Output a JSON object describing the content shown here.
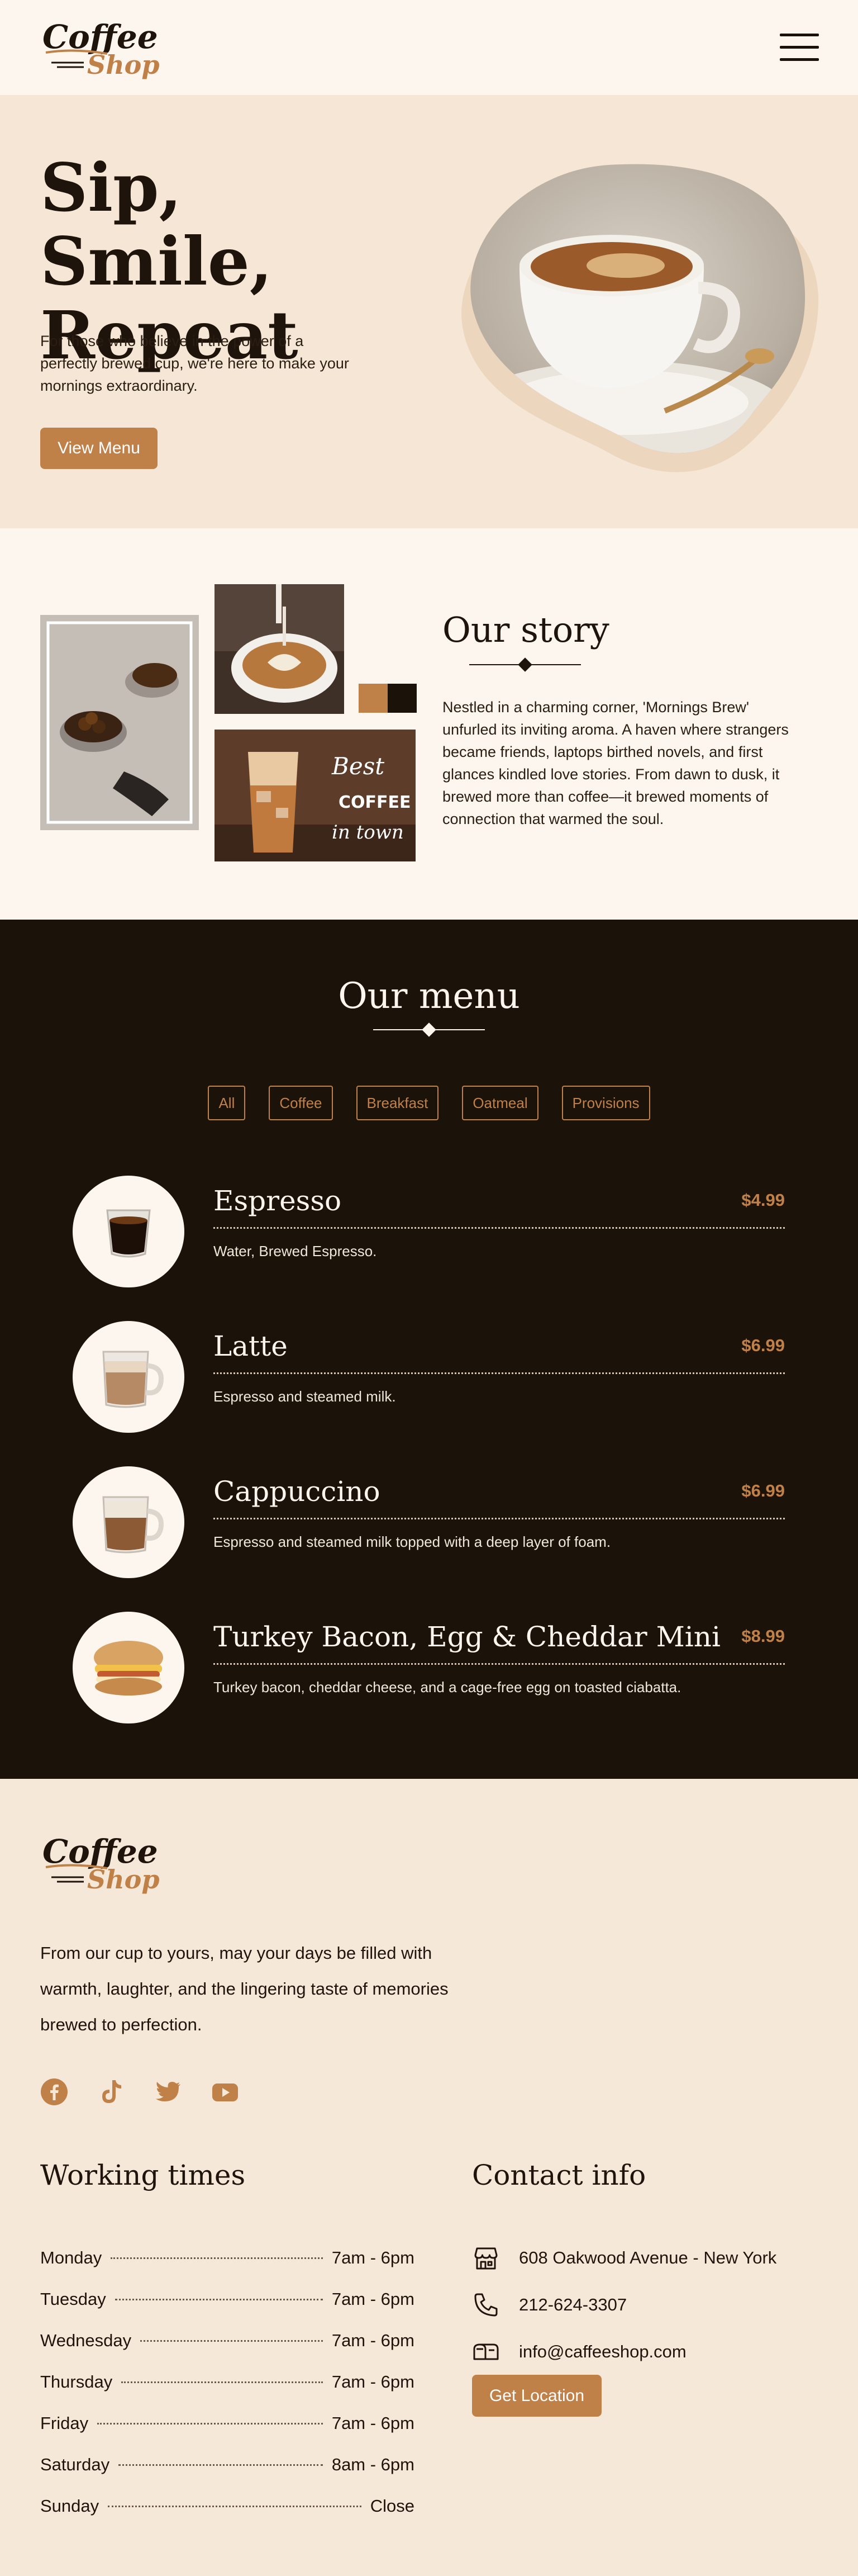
{
  "colors": {
    "accent": "#c08149",
    "dark": "#1b120a",
    "cream": "#fdf6ee",
    "beige": "#f6e6d6"
  },
  "header": {
    "logo_top": "Coffee",
    "logo_bottom": "Shop"
  },
  "hero": {
    "title_line1": "Sip, Smile,",
    "title_line2": "Repeat",
    "text": "For those who believe in the power of a perfectly brewed cup, we're here to make your mornings extraordinary.",
    "button": "View Menu"
  },
  "story": {
    "title": "Our story",
    "text": "Nestled in a charming corner, 'Mornings Brew' unfurled its inviting aroma. A haven where strangers became friends, laptops birthed novels, and first glances kindled love stories. From dawn to dusk, it brewed more than coffee—it brewed moments of connection that warmed the soul.",
    "photo_sign": {
      "line1": "Best",
      "line2": "COFFEE",
      "line3": "in town"
    }
  },
  "menu": {
    "title": "Our menu",
    "filters": [
      "All",
      "Coffee",
      "Breakfast",
      "Oatmeal",
      "Provisions"
    ],
    "items": [
      {
        "name": "Espresso",
        "price": "$4.99",
        "desc": "Water, Brewed Espresso.",
        "icon": "espresso-glass"
      },
      {
        "name": "Latte",
        "price": "$6.99",
        "desc": "Espresso and steamed milk.",
        "icon": "latte-mug"
      },
      {
        "name": "Cappuccino",
        "price": "$6.99",
        "desc": "Espresso and steamed milk topped with a deep layer of foam.",
        "icon": "cappuccino-mug"
      },
      {
        "name": "Turkey Bacon, Egg & Cheddar Mini",
        "price": "$8.99",
        "desc": "Turkey bacon, cheddar cheese, and a cage-free egg on toasted ciabatta.",
        "icon": "sandwich"
      }
    ]
  },
  "footer": {
    "logo_top": "Coffee",
    "logo_bottom": "Shop",
    "tagline": "From our cup to yours, may your days be filled with warmth, laughter, and the lingering taste of memories brewed to perfection.",
    "socials": [
      "facebook-icon",
      "tiktok-icon",
      "twitter-icon",
      "youtube-icon"
    ],
    "working_title": "Working times",
    "hours": [
      {
        "day": "Monday",
        "time": "7am - 6pm"
      },
      {
        "day": "Tuesday",
        "time": "7am - 6pm"
      },
      {
        "day": "Wednesday",
        "time": "7am - 6pm"
      },
      {
        "day": "Thursday",
        "time": "7am - 6pm"
      },
      {
        "day": "Friday",
        "time": "7am - 6pm"
      },
      {
        "day": "Saturday",
        "time": "8am - 6pm"
      },
      {
        "day": "Sunday",
        "time": "Close"
      }
    ],
    "contact_title": "Contact info",
    "address": "608 Oakwood Avenue - New York",
    "phone": "212-624-3307",
    "email": "info@caffeeshop.com",
    "location_button": "Get Location"
  }
}
